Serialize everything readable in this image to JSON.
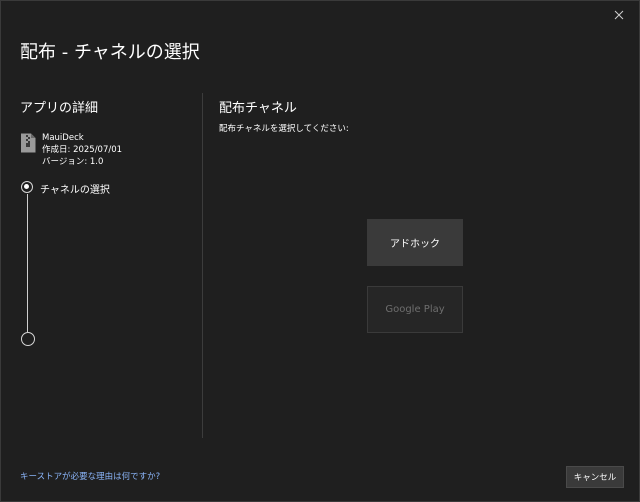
{
  "window": {
    "title": "配布 - チャネルの選択",
    "close_icon": "close-icon"
  },
  "app_details": {
    "heading": "アプリの詳細",
    "file_icon": "zip-file-icon",
    "name": "MauiDeck",
    "created": "作成日: 2025/07/01",
    "version": "バージョン: 1.0"
  },
  "steps": [
    {
      "label": "チャネルの選択",
      "state": "current"
    },
    {
      "label": "",
      "state": "pending"
    }
  ],
  "channel": {
    "heading": "配布チャネル",
    "instruction": "配布チャネルを選択してください:",
    "options": [
      {
        "label": "アドホック",
        "enabled": true
      },
      {
        "label": "Google Play",
        "enabled": false
      }
    ]
  },
  "footer": {
    "help_link": "キーストアが必要な理由は何ですか?",
    "cancel_label": "キャンセル"
  },
  "colors": {
    "background": "#1f1f1f",
    "button": "#3a3a3a",
    "link": "#8ab4f8",
    "disabled_text": "#6e6e6e"
  }
}
